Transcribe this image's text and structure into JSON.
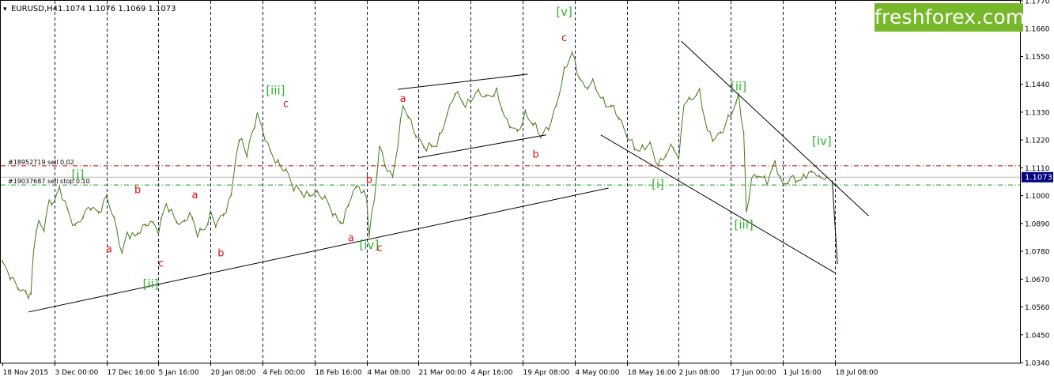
{
  "header": {
    "symbol": "EURUSD,H4",
    "quote": "1.1074 1.1076 1.1069 1.1073"
  },
  "logo": {
    "text": "freshforex.com",
    "color": "#77b82a"
  },
  "colors": {
    "background": "#ffffff",
    "frame": "#000000",
    "price_line": "#3f7f1f",
    "price_accent": "#d2691e",
    "grid": "#101060",
    "sell_line": "#cc0000",
    "stop_line": "#1a9a1a",
    "current_price_bg": "#000080",
    "wave_green": "#2db52d",
    "wave_red": "#e01010",
    "trend_lines": "#000000"
  },
  "chart_data": {
    "type": "line",
    "symbol": "EURUSD",
    "timeframe": "H4",
    "x_tick_labels": [
      "18 Nov 2015",
      "3 Dec 00:00",
      "17 Dec 16:00",
      "5 Jan 16:00",
      "20 Jan 08:00",
      "4 Feb 00:00",
      "18 Feb 16:00",
      "4 Mar 08:00",
      "21 Mar 00:00",
      "4 Apr 16:00",
      "19 Apr 08:00",
      "4 May 00:00",
      "18 May 16:00",
      "2 Jun 08:00",
      "17 Jun 00:00",
      "1 Jul 16:00",
      "18 Jul 08:00"
    ],
    "y_tick_labels": [
      "1.1770",
      "1.1660",
      "1.1550",
      "1.1440",
      "1.1330",
      "1.1220",
      "1.1110",
      "1.1000",
      "1.0890",
      "1.0780",
      "1.0670",
      "1.0560",
      "1.0450",
      "1.0340"
    ],
    "ylim": [
      1.034,
      1.177
    ],
    "x_index_range": [
      0,
      16
    ],
    "current_price": "1.1073",
    "price_path": [
      [
        0,
        1.0735
      ],
      [
        0.1,
        1.069
      ],
      [
        0.25,
        1.065
      ],
      [
        0.4,
        1.063
      ],
      [
        0.5,
        1.061
      ],
      [
        0.55,
        1.06
      ],
      [
        0.6,
        1.079
      ],
      [
        0.7,
        1.09
      ],
      [
        0.8,
        1.088
      ],
      [
        0.9,
        1.098
      ],
      [
        1.0,
        1.097
      ],
      [
        1.1,
        1.102
      ],
      [
        1.25,
        1.095
      ],
      [
        1.4,
        1.088
      ],
      [
        1.55,
        1.091
      ],
      [
        1.7,
        1.096
      ],
      [
        1.85,
        1.094
      ],
      [
        2.0,
        1.099
      ],
      [
        2.1,
        1.093
      ],
      [
        2.2,
        1.086
      ],
      [
        2.3,
        1.078
      ],
      [
        2.4,
        1.086
      ],
      [
        2.55,
        1.083
      ],
      [
        2.7,
        1.087
      ],
      [
        2.85,
        1.091
      ],
      [
        3.0,
        1.086
      ],
      [
        3.15,
        1.096
      ],
      [
        3.3,
        1.092
      ],
      [
        3.45,
        1.089
      ],
      [
        3.6,
        1.092
      ],
      [
        3.75,
        1.085
      ],
      [
        3.9,
        1.088
      ],
      [
        4.0,
        1.093
      ],
      [
        4.1,
        1.088
      ],
      [
        4.25,
        1.092
      ],
      [
        4.4,
        1.101
      ],
      [
        4.5,
        1.118
      ],
      [
        4.6,
        1.122
      ],
      [
        4.7,
        1.115
      ],
      [
        4.8,
        1.125
      ],
      [
        4.9,
        1.133
      ],
      [
        5.0,
        1.127
      ],
      [
        5.1,
        1.119
      ],
      [
        5.25,
        1.113
      ],
      [
        5.45,
        1.111
      ],
      [
        5.6,
        1.103
      ],
      [
        5.8,
        1.1
      ],
      [
        6.0,
        1.102
      ],
      [
        6.2,
        1.098
      ],
      [
        6.4,
        1.092
      ],
      [
        6.55,
        1.09
      ],
      [
        6.7,
        1.099
      ],
      [
        6.85,
        1.104
      ],
      [
        7.0,
        1.1
      ],
      [
        7.05,
        1.085
      ],
      [
        7.15,
        1.098
      ],
      [
        7.25,
        1.119
      ],
      [
        7.35,
        1.113
      ],
      [
        7.5,
        1.108
      ],
      [
        7.6,
        1.12
      ],
      [
        7.7,
        1.135
      ],
      [
        7.85,
        1.129
      ],
      [
        8.0,
        1.123
      ],
      [
        8.15,
        1.118
      ],
      [
        8.35,
        1.12
      ],
      [
        8.5,
        1.13
      ],
      [
        8.7,
        1.14
      ],
      [
        8.9,
        1.136
      ],
      [
        9.1,
        1.141
      ],
      [
        9.3,
        1.138
      ],
      [
        9.5,
        1.142
      ],
      [
        9.7,
        1.128
      ],
      [
        9.9,
        1.125
      ],
      [
        10.05,
        1.133
      ],
      [
        10.2,
        1.128
      ],
      [
        10.35,
        1.123
      ],
      [
        10.5,
        1.128
      ],
      [
        10.65,
        1.136
      ],
      [
        10.8,
        1.148
      ],
      [
        10.95,
        1.157
      ],
      [
        11.05,
        1.15
      ],
      [
        11.2,
        1.142
      ],
      [
        11.35,
        1.144
      ],
      [
        11.55,
        1.138
      ],
      [
        11.75,
        1.134
      ],
      [
        11.9,
        1.128
      ],
      [
        12.05,
        1.123
      ],
      [
        12.25,
        1.117
      ],
      [
        12.45,
        1.12
      ],
      [
        12.6,
        1.113
      ],
      [
        12.75,
        1.116
      ],
      [
        12.9,
        1.119
      ],
      [
        13.0,
        1.114
      ],
      [
        13.1,
        1.138
      ],
      [
        13.25,
        1.138
      ],
      [
        13.4,
        1.14
      ],
      [
        13.55,
        1.126
      ],
      [
        13.7,
        1.123
      ],
      [
        13.85,
        1.125
      ],
      [
        14.0,
        1.132
      ],
      [
        14.15,
        1.14
      ],
      [
        14.25,
        1.125
      ],
      [
        14.3,
        1.092
      ],
      [
        14.4,
        1.106
      ],
      [
        14.55,
        1.109
      ],
      [
        14.7,
        1.106
      ],
      [
        14.85,
        1.112
      ],
      [
        15.0,
        1.104
      ],
      [
        15.15,
        1.108
      ],
      [
        15.35,
        1.105
      ],
      [
        15.5,
        1.109
      ],
      [
        15.65,
        1.11
      ],
      [
        15.75,
        1.106
      ],
      [
        15.85,
        1.1073
      ]
    ],
    "order_lines": [
      {
        "label": "#18952719 sell 0.02",
        "price": 1.1118,
        "color": "#cc0000"
      },
      {
        "label": "#19037687 sell stop 0.10",
        "price": 1.1042,
        "color": "#1a9a1a"
      }
    ],
    "current_price_line": 1.1073,
    "trend_lines": [
      {
        "from": [
          0.5,
          1.054
        ],
        "to": [
          11.65,
          1.103
        ]
      },
      {
        "from": [
          7.6,
          1.142
        ],
        "to": [
          10.1,
          1.148
        ]
      },
      {
        "from": [
          8.0,
          1.115
        ],
        "to": [
          10.45,
          1.124
        ]
      },
      {
        "from": [
          11.5,
          1.124
        ],
        "to": [
          16.0,
          1.0695
        ]
      },
      {
        "from": [
          13.05,
          1.161
        ],
        "to": [
          16.65,
          1.092
        ]
      },
      {
        "from": [
          15.95,
          1.106
        ],
        "to": [
          16.05,
          1.073
        ]
      }
    ],
    "wave_labels": [
      {
        "text": "[i]",
        "x": 1.45,
        "y": 1.1068,
        "color": "green"
      },
      {
        "text": "[ii]",
        "x": 2.85,
        "y": 1.0635,
        "color": "green"
      },
      {
        "text": "[iii]",
        "x": 5.25,
        "y": 1.14,
        "color": "green"
      },
      {
        "text": "[iv]",
        "x": 7.05,
        "y": 1.079,
        "color": "green"
      },
      {
        "text": "[v]",
        "x": 10.8,
        "y": 1.171,
        "color": "green"
      },
      {
        "text": "[i]",
        "x": 12.6,
        "y": 1.103,
        "color": "green"
      },
      {
        "text": "[ii]",
        "x": 14.15,
        "y": 1.1415,
        "color": "green"
      },
      {
        "text": "[iii]",
        "x": 14.25,
        "y": 1.087,
        "color": "green"
      },
      {
        "text": "[iv]",
        "x": 15.75,
        "y": 1.12,
        "color": "green"
      },
      {
        "text": "a",
        "x": 2.05,
        "y": 1.0775,
        "color": "red"
      },
      {
        "text": "b",
        "x": 2.6,
        "y": 1.101,
        "color": "red"
      },
      {
        "text": "c",
        "x": 3.05,
        "y": 1.072,
        "color": "red"
      },
      {
        "text": "a",
        "x": 3.7,
        "y": 1.099,
        "color": "red"
      },
      {
        "text": "b",
        "x": 4.2,
        "y": 1.076,
        "color": "red"
      },
      {
        "text": "c",
        "x": 5.45,
        "y": 1.135,
        "color": "red"
      },
      {
        "text": "a",
        "x": 6.7,
        "y": 1.082,
        "color": "red"
      },
      {
        "text": "b",
        "x": 7.05,
        "y": 1.105,
        "color": "red"
      },
      {
        "text": "c",
        "x": 7.25,
        "y": 1.078,
        "color": "red"
      },
      {
        "text": "a",
        "x": 7.7,
        "y": 1.137,
        "color": "red"
      },
      {
        "text": "b",
        "x": 10.25,
        "y": 1.115,
        "color": "red"
      },
      {
        "text": "c",
        "x": 10.8,
        "y": 1.161,
        "color": "red"
      }
    ],
    "grid": true,
    "grid_style": "dashed vertical"
  }
}
